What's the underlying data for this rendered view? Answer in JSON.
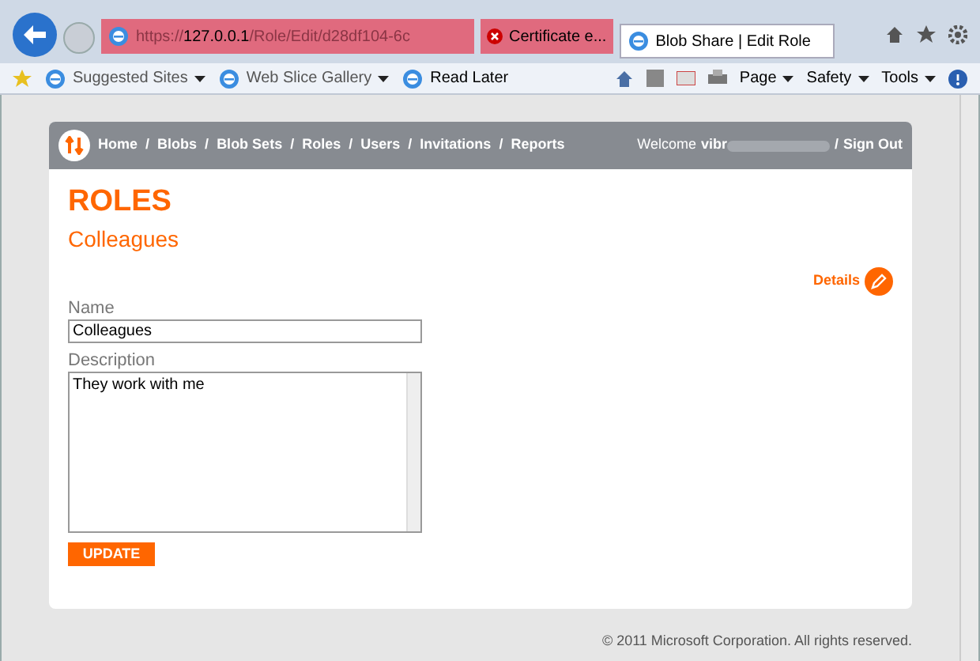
{
  "browser": {
    "url_prefix": "https://",
    "url_host": "127.0.0.1",
    "url_path": "/Role/Edit/d28df104-6c",
    "cert_label": "Certificate e...",
    "tabs": [
      {
        "label": "Blob Share | Edit Role",
        "selected": true
      }
    ],
    "favorites": [
      {
        "label": "Suggested Sites",
        "dropdown": true
      },
      {
        "label": "Web Slice Gallery",
        "dropdown": true
      },
      {
        "label": "Read Later",
        "dropdown": false
      }
    ],
    "commands": [
      "Page",
      "Safety",
      "Tools"
    ]
  },
  "nav": {
    "links": [
      "Home",
      "Blobs",
      "Blob Sets",
      "Roles",
      "Users",
      "Invitations",
      "Reports"
    ],
    "separator": "/",
    "welcome": "Welcome",
    "user": "vibr",
    "sign_out": "Sign Out"
  },
  "heading": "ROLES",
  "subheading": "Colleagues",
  "details_link": "Details",
  "form": {
    "name_label": "Name",
    "name_value": "Colleagues",
    "description_label": "Description",
    "description_value": "They work with me",
    "submit": "UPDATE"
  },
  "footer": "© 2011 Microsoft Corporation. All rights reserved."
}
